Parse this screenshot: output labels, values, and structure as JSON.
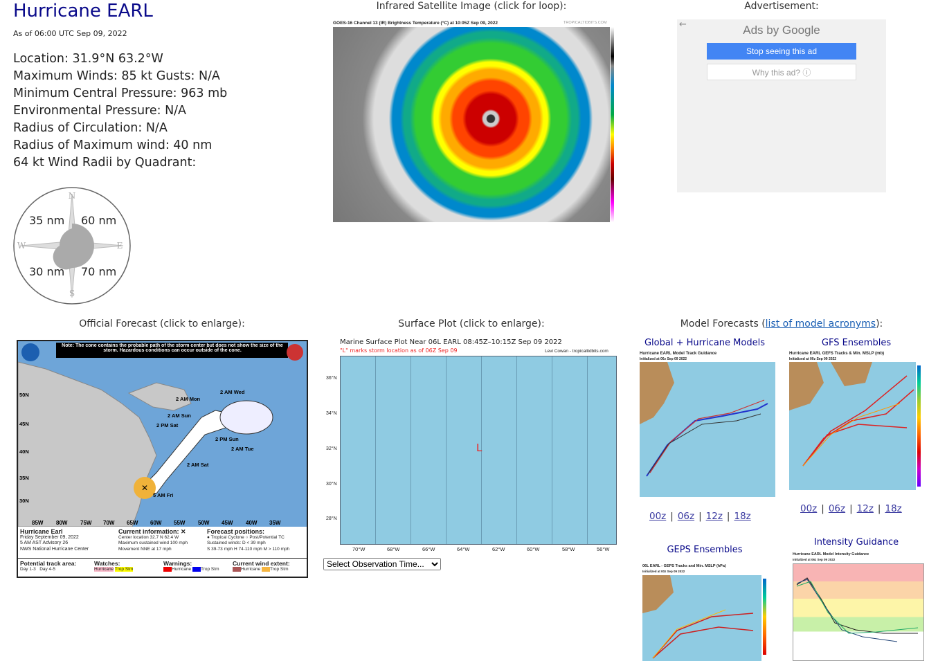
{
  "storm": {
    "title": "Hurricane EARL",
    "as_of": "As of 06:00 UTC Sep 09, 2022",
    "stats": [
      "Location: 31.9°N 63.2°W",
      "Maximum Winds: 85 kt  Gusts: N/A",
      "Minimum Central Pressure: 963 mb",
      "Environmental Pressure: N/A",
      "Radius of Circulation: N/A",
      "Radius of Maximum wind: 40 nm",
      "64 kt Wind Radii by Quadrant:"
    ],
    "wind_radii": {
      "ne": "60 nm",
      "nw": "35 nm",
      "sw": "30 nm",
      "se": "70 nm"
    },
    "compass": {
      "n": "N",
      "s": "S",
      "e": "E",
      "w": "W"
    }
  },
  "satellite": {
    "caption": "Infrared Satellite Image (click for loop):",
    "header": "GOES-16 Channel 13 (IR) Brightness Temperature (°C) at 10:05Z Sep 09, 2022",
    "credit": "TROPICALTIDBITS.COM"
  },
  "ad": {
    "caption": "Advertisement:",
    "ads_by": "Ads by Google",
    "stop": "Stop seeing this ad",
    "why": "Why this ad? ⓘ"
  },
  "official": {
    "caption": "Official Forecast (click to enlarge):",
    "note": "Note: The cone contains the probable path of the storm center but does not show the size of the storm. Hazardous conditions can occur outside of the cone.",
    "labels": [
      "2 AM Wed",
      "2 AM Mon",
      "2 AM Sun",
      "2 PM Sat",
      "2 PM Sun",
      "2 AM Tue",
      "2 AM Sat",
      "5 AM Fri"
    ],
    "lat_labels": [
      "50N",
      "45N",
      "40N",
      "35N",
      "30N"
    ],
    "lon_labels": [
      "85W",
      "80W",
      "75W",
      "70W",
      "65W",
      "60W",
      "55W",
      "50W",
      "45W",
      "40W",
      "35W"
    ],
    "legend": {
      "name": "Hurricane Earl",
      "date": "Friday September 09, 2022",
      "advisory": "5 AM AST Advisory 26",
      "center": "NWS National Hurricane Center",
      "current_title": "Current information: ✕",
      "current": [
        "Center location 32.7 N 62.4 W",
        "Maximum sustained wind 100 mph",
        "Movement NNE at 17 mph"
      ],
      "forecast_title": "Forecast positions:",
      "forecast": [
        "● Tropical Cyclone  ○ Post/Potential TC",
        "Sustained winds:     D < 39 mph",
        "S 39-73 mph  H 74-110 mph  M > 110 mph"
      ],
      "track_title": "Potential track area:",
      "track": [
        "Day 1-3",
        "Day 4-5"
      ],
      "watches_title": "Watches:",
      "watches": [
        "Hurricane",
        "Trop Stm"
      ],
      "warnings_title": "Warnings:",
      "warnings": [
        "Hurricane",
        "Trop Stm"
      ],
      "extent_title": "Current wind extent:",
      "extent": [
        "Hurricane",
        "Trop Stm"
      ]
    }
  },
  "surface": {
    "caption": "Surface Plot (click to enlarge):",
    "title": "Marine Surface Plot Near 06L EARL 08:45Z–10:15Z Sep 09 2022",
    "subtitle": "\"L\" marks storm location as of 06Z Sep 09",
    "credit": "Levi Cowan - tropicaltidbits.com",
    "storm_mark": "L",
    "lat_labels": [
      "36°N",
      "34°N",
      "32°N",
      "30°N",
      "28°N"
    ],
    "lon_labels": [
      "70°W",
      "68°W",
      "66°W",
      "64°W",
      "62°W",
      "60°W",
      "58°W",
      "56°W"
    ],
    "select": "Select Observation Time..."
  },
  "models": {
    "caption_prefix": "Model Forecasts (",
    "link": "list of model acronyms",
    "caption_suffix": "):",
    "global": {
      "title": "Global + Hurricane Models",
      "chart_title": "Hurricane EARL Model Track Guidance",
      "init": "Initialized at 06z Sep 09 2022"
    },
    "gfs": {
      "title": "GFS Ensembles",
      "chart_title": "Hurricane EARL GEFS Tracks & Min. MSLP (mb)",
      "init": "Initialized at 00z Sep 09 2022"
    },
    "geps": {
      "title": "GEPS Ensembles",
      "chart_title": "06L EARL - GEPS Tracks and Min. MSLP (hPa)",
      "init": "Initialized at 00z Sep 09 2022"
    },
    "intensity": {
      "title": "Intensity Guidance",
      "chart_title": "Hurricane EARL Model Intensity Guidance",
      "init": "Initialized at 06z Sep 09 2022"
    },
    "runs": [
      "00z",
      "06z",
      "12z",
      "18z"
    ]
  }
}
